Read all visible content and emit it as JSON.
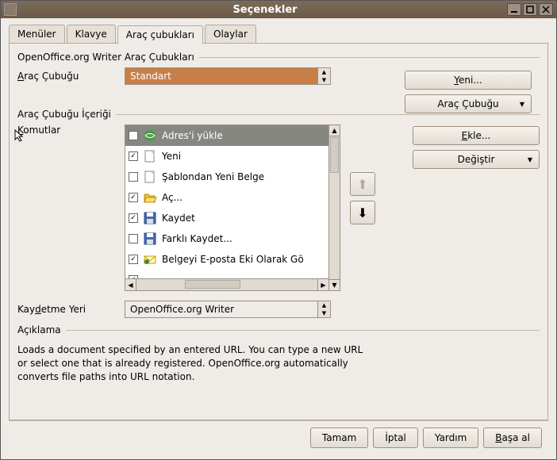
{
  "window": {
    "title": "Seçenekler"
  },
  "tabs": [
    "Menüler",
    "Klavye",
    "Araç çubukları",
    "Olaylar"
  ],
  "active_tab": 2,
  "section1": {
    "legend": "OpenOffice.org Writer Araç Çubukları",
    "label": "Araç Çubuğu",
    "value": "Standart",
    "btn_new": "Yeni...",
    "btn_toolbar": "Araç Çubuğu"
  },
  "section2": {
    "legend": "Araç Çubuğu İçeriği",
    "label": "Komutlar",
    "btn_add": "Ekle...",
    "btn_modify": "Değiştir",
    "items": [
      {
        "checked": false,
        "label": "Adres'i yükle",
        "selected": true,
        "icon": "url"
      },
      {
        "checked": true,
        "label": "Yeni",
        "icon": "doc"
      },
      {
        "checked": false,
        "label": "Şablondan Yeni Belge",
        "icon": "doc"
      },
      {
        "checked": true,
        "label": "Aç...",
        "icon": "open"
      },
      {
        "checked": true,
        "label": "Kaydet",
        "icon": "save"
      },
      {
        "checked": false,
        "label": "Farklı Kaydet...",
        "icon": "save"
      },
      {
        "checked": true,
        "label": "Belgeyi E-posta Eki Olarak Gö",
        "icon": "mail"
      },
      {
        "checked": true,
        "label": "---------------------------------",
        "icon": ""
      }
    ]
  },
  "save_loc": {
    "label": "Kaydetme Yeri",
    "value": "OpenOffice.org Writer"
  },
  "desc": {
    "legend": "Açıklama",
    "text": "Loads a document specified by an entered URL. You can type a new URL or select one that is already registered. OpenOffice.org automatically converts file paths into URL notation."
  },
  "buttons": {
    "ok": "Tamam",
    "cancel": "İptal",
    "help": "Yardım",
    "reset": "Başa al"
  }
}
